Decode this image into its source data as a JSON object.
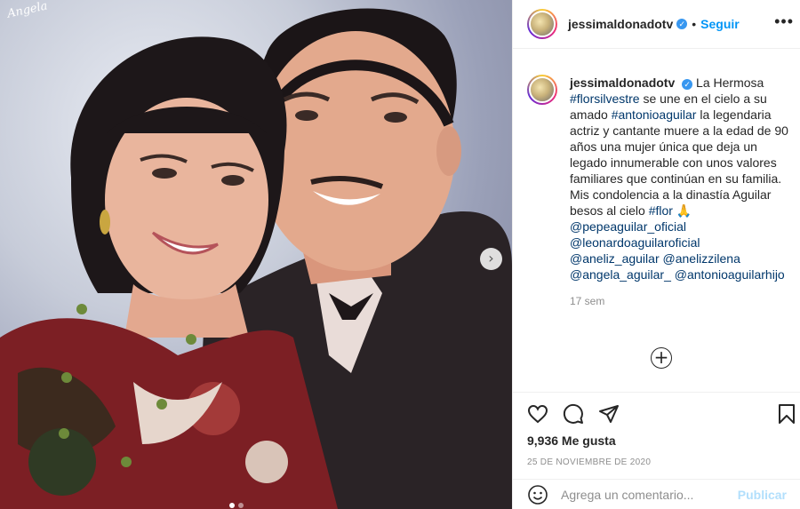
{
  "photo": {
    "signature": "Angela"
  },
  "header": {
    "username": "jessimaldonadotv",
    "verified_mark": "✓",
    "separator": "•",
    "follow_label": "Seguir",
    "more_label": "•••"
  },
  "caption": {
    "username": "jessimaldonadotv",
    "segments": [
      "La Hermosa ",
      "#florsilvestre",
      " se une en el cielo a su amado ",
      "#antonioaguilar",
      " la legendaria actriz y cantante muere a la edad de 90 años una mujer única que deja un legado innumerable con unos valores familiares que continúan en su familia. Mis condolencia a la dinastía Aguilar besos al cielo ",
      "#flor",
      " 🙏 ",
      "@pepeaguilar_oficial",
      " ",
      "@leonardoaguilaroficial",
      " ",
      "@aneliz_aguilar",
      " ",
      "@anelizzilena",
      " ",
      "@angela_aguilar_",
      " ",
      "@antonioaguilarhijo"
    ],
    "time": "17 sem"
  },
  "load_more_label": "+",
  "stats": {
    "likes": "9,936 Me gusta",
    "date": "25 DE NOVIEMBRE DE 2020"
  },
  "comment": {
    "placeholder": "Agrega un comentario...",
    "publish_label": "Publicar"
  },
  "carousel": {
    "next_label": "›",
    "dots": 2,
    "active_dot": 1
  },
  "icons": [
    "heart-icon",
    "comment-icon",
    "share-icon",
    "bookmark-icon",
    "emoji-icon",
    "chevron-right-icon",
    "more-icon"
  ],
  "colors": {
    "accent": "#0095f6",
    "hashtag": "#00376b",
    "muted": "#8e8e8e",
    "publish_disabled": "#b2dffc"
  }
}
